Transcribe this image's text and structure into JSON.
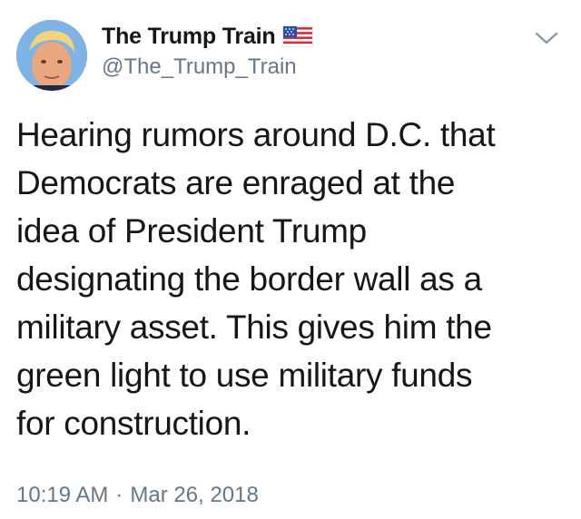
{
  "tweet": {
    "author": {
      "display_name": "The Trump Train",
      "handle": "@The_Trump_Train",
      "avatar": "avatar-photo",
      "flag": "us-flag-icon"
    },
    "text": "Hearing rumors around D.C. that\nDemocrats are enraged at the\nidea of President Trump\ndesignating the border wall as a\nmilitary asset. This gives him the\ngreen light to use military funds\nfor construction.",
    "time": "10:19 AM",
    "separator": "·",
    "date": "Mar 26, 2018",
    "menu_icon": "chevron-down-icon"
  },
  "colors": {
    "text": "#14171a",
    "secondary": "#657786",
    "background": "#ffffff"
  }
}
